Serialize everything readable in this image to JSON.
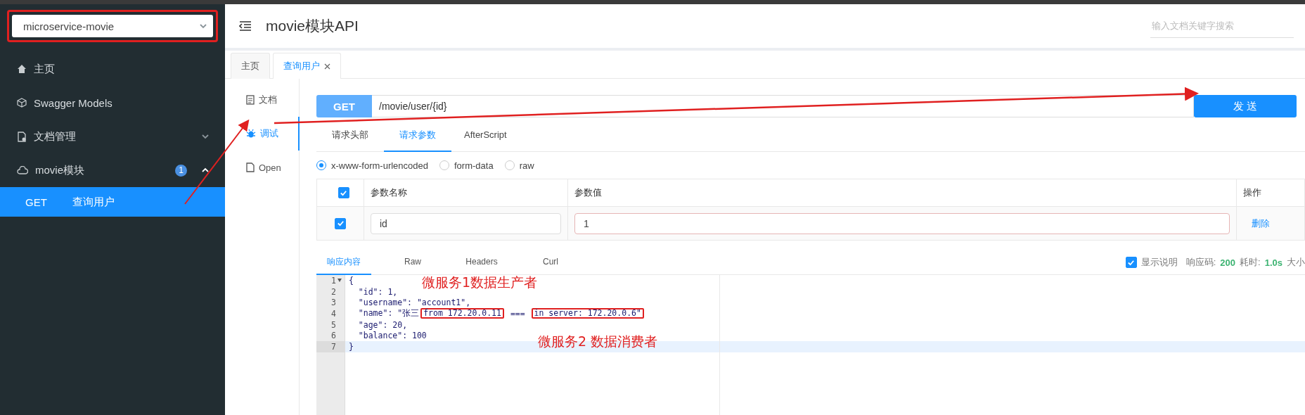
{
  "sidebar": {
    "service_select": {
      "value": "microservice-movie",
      "outlined": true
    },
    "items": [
      {
        "kind": "link",
        "label": "主页"
      },
      {
        "kind": "link",
        "label": "Swagger Models"
      },
      {
        "kind": "group",
        "label": "文档管理",
        "expanded": false
      },
      {
        "kind": "group",
        "label": "movie模块",
        "badge": "1",
        "expanded": true,
        "children": [
          {
            "method": "GET",
            "label": "查询用户",
            "selected": true
          }
        ]
      }
    ]
  },
  "header": {
    "title": "movie模块API",
    "search": {
      "placeholder": "输入文档关键字搜索"
    }
  },
  "tabs": [
    {
      "label": "主页",
      "selected": false,
      "closable": false
    },
    {
      "label": "查询用户",
      "selected": true,
      "closable": true
    }
  ],
  "side_nav": [
    {
      "label": "文档",
      "selected": false
    },
    {
      "label": "调试",
      "selected": true
    },
    {
      "label": "Open",
      "selected": false
    }
  ],
  "request": {
    "method": "GET",
    "url": "/movie/user/{id}",
    "send_label": "发 送"
  },
  "request_tabs": [
    {
      "label": "请求头部",
      "selected": false
    },
    {
      "label": "请求参数",
      "selected": true
    },
    {
      "label": "AfterScript",
      "selected": false
    }
  ],
  "body_types": [
    {
      "label": "x-www-form-urlencoded",
      "selected": true
    },
    {
      "label": "form-data",
      "selected": false
    },
    {
      "label": "raw",
      "selected": false
    }
  ],
  "params": {
    "header_checked": true,
    "columns": [
      "参数名称",
      "参数值",
      "操作"
    ],
    "rows": [
      {
        "checked": true,
        "name": "id",
        "value": "1",
        "action": "删除"
      }
    ]
  },
  "response_tabs": [
    {
      "label": "响应内容",
      "selected": true
    },
    {
      "label": "Raw",
      "selected": false
    },
    {
      "label": "Headers",
      "selected": false
    },
    {
      "label": "Curl",
      "selected": false
    }
  ],
  "response_meta": {
    "show_description": {
      "label": "显示说明",
      "checked": true
    },
    "status_label": "响应码:",
    "status": "200",
    "time_label": "耗时:",
    "time": "1.0s",
    "size_label": "大小"
  },
  "code": {
    "lines": [
      {
        "number": "1",
        "foldable": true,
        "active": false,
        "segments": [
          {
            "text": "{",
            "boxed": false
          }
        ]
      },
      {
        "number": "2",
        "foldable": false,
        "active": false,
        "segments": [
          {
            "text": "  \"id\": 1,",
            "boxed": false
          }
        ]
      },
      {
        "number": "3",
        "foldable": false,
        "active": false,
        "segments": [
          {
            "text": "  \"username\": \"account1\",",
            "boxed": false
          }
        ]
      },
      {
        "number": "4",
        "foldable": false,
        "active": false,
        "segments": [
          {
            "text": "  \"name\": \"张三",
            "boxed": false
          },
          {
            "text": "from 172.20.0.11",
            "boxed": true
          },
          {
            "text": " === ",
            "boxed": false
          },
          {
            "text": "in server: 172.20.0.6\"",
            "boxed": true
          }
        ]
      },
      {
        "number": "5",
        "foldable": false,
        "active": false,
        "segments": [
          {
            "text": "  \"age\": 20,",
            "boxed": false
          }
        ]
      },
      {
        "number": "6",
        "foldable": false,
        "active": false,
        "segments": [
          {
            "text": "  \"balance\": 100",
            "boxed": false
          }
        ]
      },
      {
        "number": "7",
        "foldable": false,
        "active": true,
        "segments": [
          {
            "text": "}",
            "boxed": false
          }
        ]
      }
    ]
  },
  "annotations": [
    "微服务1数据生产者",
    "微服务2 数据消费者"
  ]
}
